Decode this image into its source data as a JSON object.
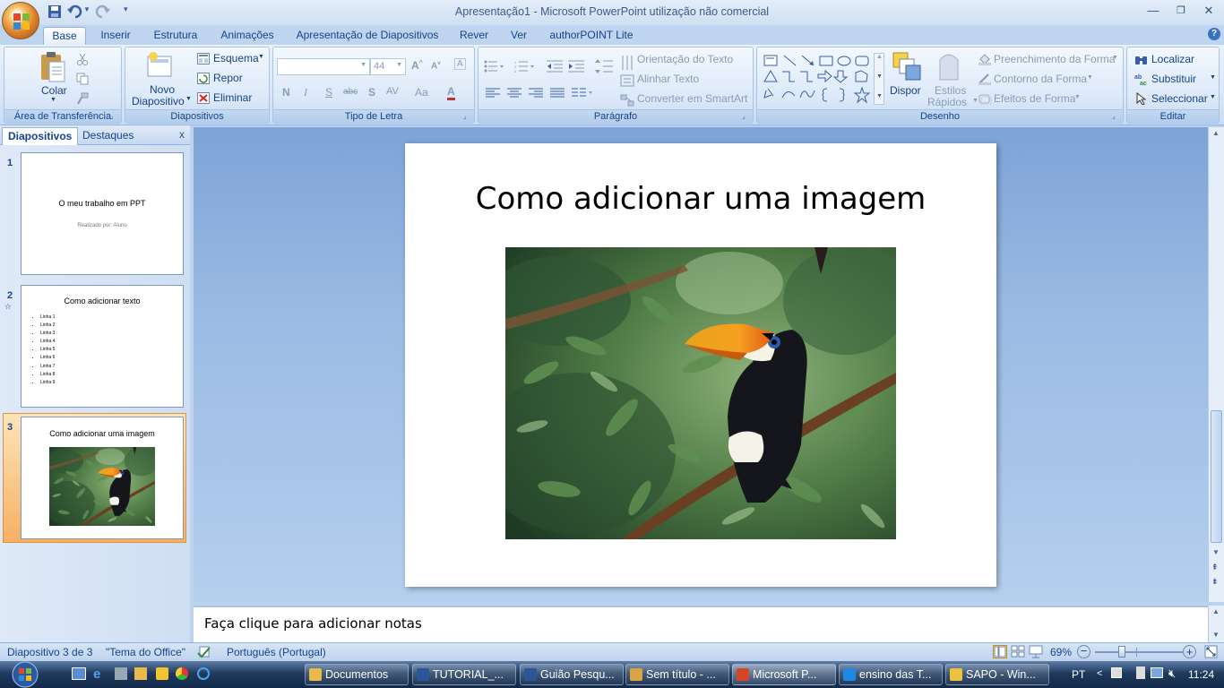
{
  "app": {
    "title": "Apresentação1 - Microsoft PowerPoint utilização não comercial"
  },
  "ribbon_tabs": [
    {
      "label": "Base"
    },
    {
      "label": "Inserir"
    },
    {
      "label": "Estrutura"
    },
    {
      "label": "Animações"
    },
    {
      "label": "Apresentação de Diapositivos"
    },
    {
      "label": "Rever"
    },
    {
      "label": "Ver"
    },
    {
      "label": "authorPOINT Lite"
    }
  ],
  "ribbon": {
    "clipboard": {
      "paste": "Colar",
      "label": "Área de Transferência"
    },
    "slides": {
      "new_slide_1": "Novo",
      "new_slide_2": "Diapositivo",
      "layout": "Esquema",
      "reset": "Repor",
      "delete": "Eliminar",
      "label": "Diapositivos"
    },
    "font": {
      "size": "44",
      "bold": "N",
      "italic": "I",
      "underline": "S",
      "strike": "abc",
      "shadow": "S",
      "spacing": "AV",
      "case": "Aa",
      "color": "A",
      "label": "Tipo de Letra"
    },
    "paragraph": {
      "text_direction": "Orientação do Texto",
      "align_text": "Alinhar Texto",
      "smartart": "Converter em SmartArt",
      "label": "Parágrafo"
    },
    "drawing": {
      "arrange": "Dispor",
      "quick_styles_1": "Estilos",
      "quick_styles_2": "Rápidos",
      "fill": "Preenchimento da Forma",
      "outline": "Contorno da Forma",
      "effects": "Efeitos de Forma",
      "label": "Desenho"
    },
    "editing": {
      "find": "Localizar",
      "replace": "Substituir",
      "select": "Seleccionar",
      "label": "Editar"
    }
  },
  "left_panel": {
    "tab_slides": "Diapositivos",
    "tab_outline": "Destaques",
    "close": "x",
    "slides": [
      {
        "number": "1",
        "title": "O meu trabalho em PPT",
        "subtitle": "Realizado por: Aluno"
      },
      {
        "number": "2",
        "title": "Como adicionar texto",
        "bullets": [
          "Linha 1",
          "Linha 2",
          "Linha 3",
          "Linha 4",
          "Linha 5",
          "Linha 6",
          "Linha 7",
          "Linha 8",
          "Linha 9"
        ]
      },
      {
        "number": "3",
        "title": "Como adicionar uma imagem"
      }
    ]
  },
  "slide": {
    "title": "Como adicionar uma imagem"
  },
  "notes": {
    "placeholder": "Faça clique para adicionar notas"
  },
  "status": {
    "slide_of": "Diapositivo 3 de 3",
    "theme": "\"Tema do Office\"",
    "language": "Português (Portugal)",
    "zoom": "69%"
  },
  "taskbar": {
    "buttons": [
      {
        "label": "Documentos",
        "color": "#e9b94a"
      },
      {
        "label": "TUTORIAL_...",
        "color": "#2b579a"
      },
      {
        "label": "Guião Pesqu...",
        "color": "#2b579a"
      },
      {
        "label": "Sem título - ...",
        "color": "#d9a441"
      },
      {
        "label": "Microsoft P...",
        "color": "#d24726"
      },
      {
        "label": "ensino das T...",
        "color": "#1e88e5"
      },
      {
        "label": "SAPO - Win...",
        "color": "#f0c040"
      }
    ],
    "language": "PT",
    "time": "11:24"
  },
  "colors": {
    "accent": "#15428b",
    "ribbon_bg": "#dbe7f7",
    "selected_thumb": "#f6b064"
  }
}
